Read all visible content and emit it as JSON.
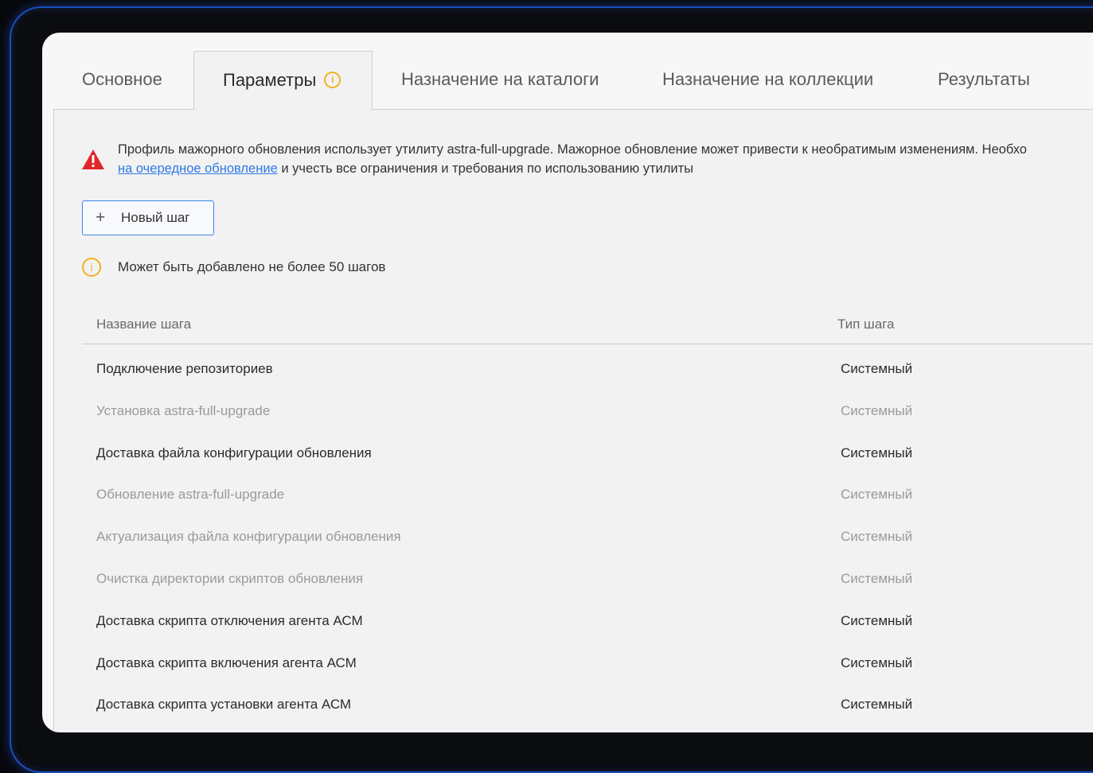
{
  "tabs": [
    {
      "label": "Основное",
      "active": false
    },
    {
      "label": "Параметры",
      "active": true,
      "icon": "info-icon"
    },
    {
      "label": "Назначение на каталоги",
      "active": false
    },
    {
      "label": "Назначение на коллекции",
      "active": false
    },
    {
      "label": "Результаты",
      "active": false
    }
  ],
  "alert": {
    "icon": "warning-triangle-icon",
    "color": "#e0262a",
    "line1": "Профиль мажорного обновления использует утилиту astra-full-upgrade. Мажорное обновление может привести к необратимым изменениям. Необхо",
    "link": "на очередное обновление",
    "line2_rest": " и учесть все ограничения и требования по использованию утилиты"
  },
  "new_step_button": {
    "icon": "+",
    "label": "Новый шаг"
  },
  "limit_notice": {
    "icon": "i",
    "text": "Может быть добавлено не более 50 шагов"
  },
  "table": {
    "headers": {
      "name": "Название шага",
      "type": "Тип шага"
    },
    "rows": [
      {
        "name": "Подключение репозиториев",
        "type": "Системный",
        "enabled": true
      },
      {
        "name": "Установка astra-full-upgrade",
        "type": "Системный",
        "enabled": false
      },
      {
        "name": "Доставка файла конфигурации обновления",
        "type": "Системный",
        "enabled": true
      },
      {
        "name": "Обновление astra-full-upgrade",
        "type": "Системный",
        "enabled": false
      },
      {
        "name": "Актуализация файла конфигурации обновления",
        "type": "Системный",
        "enabled": false
      },
      {
        "name": "Очистка директории скриптов обновления",
        "type": "Системный",
        "enabled": false
      },
      {
        "name": "Доставка скрипта отключения агента АСМ",
        "type": "Системный",
        "enabled": true
      },
      {
        "name": "Доставка скрипта включения агента АСМ",
        "type": "Системный",
        "enabled": true
      },
      {
        "name": "Доставка скрипта установки агента АСМ",
        "type": "Системный",
        "enabled": true
      }
    ]
  }
}
